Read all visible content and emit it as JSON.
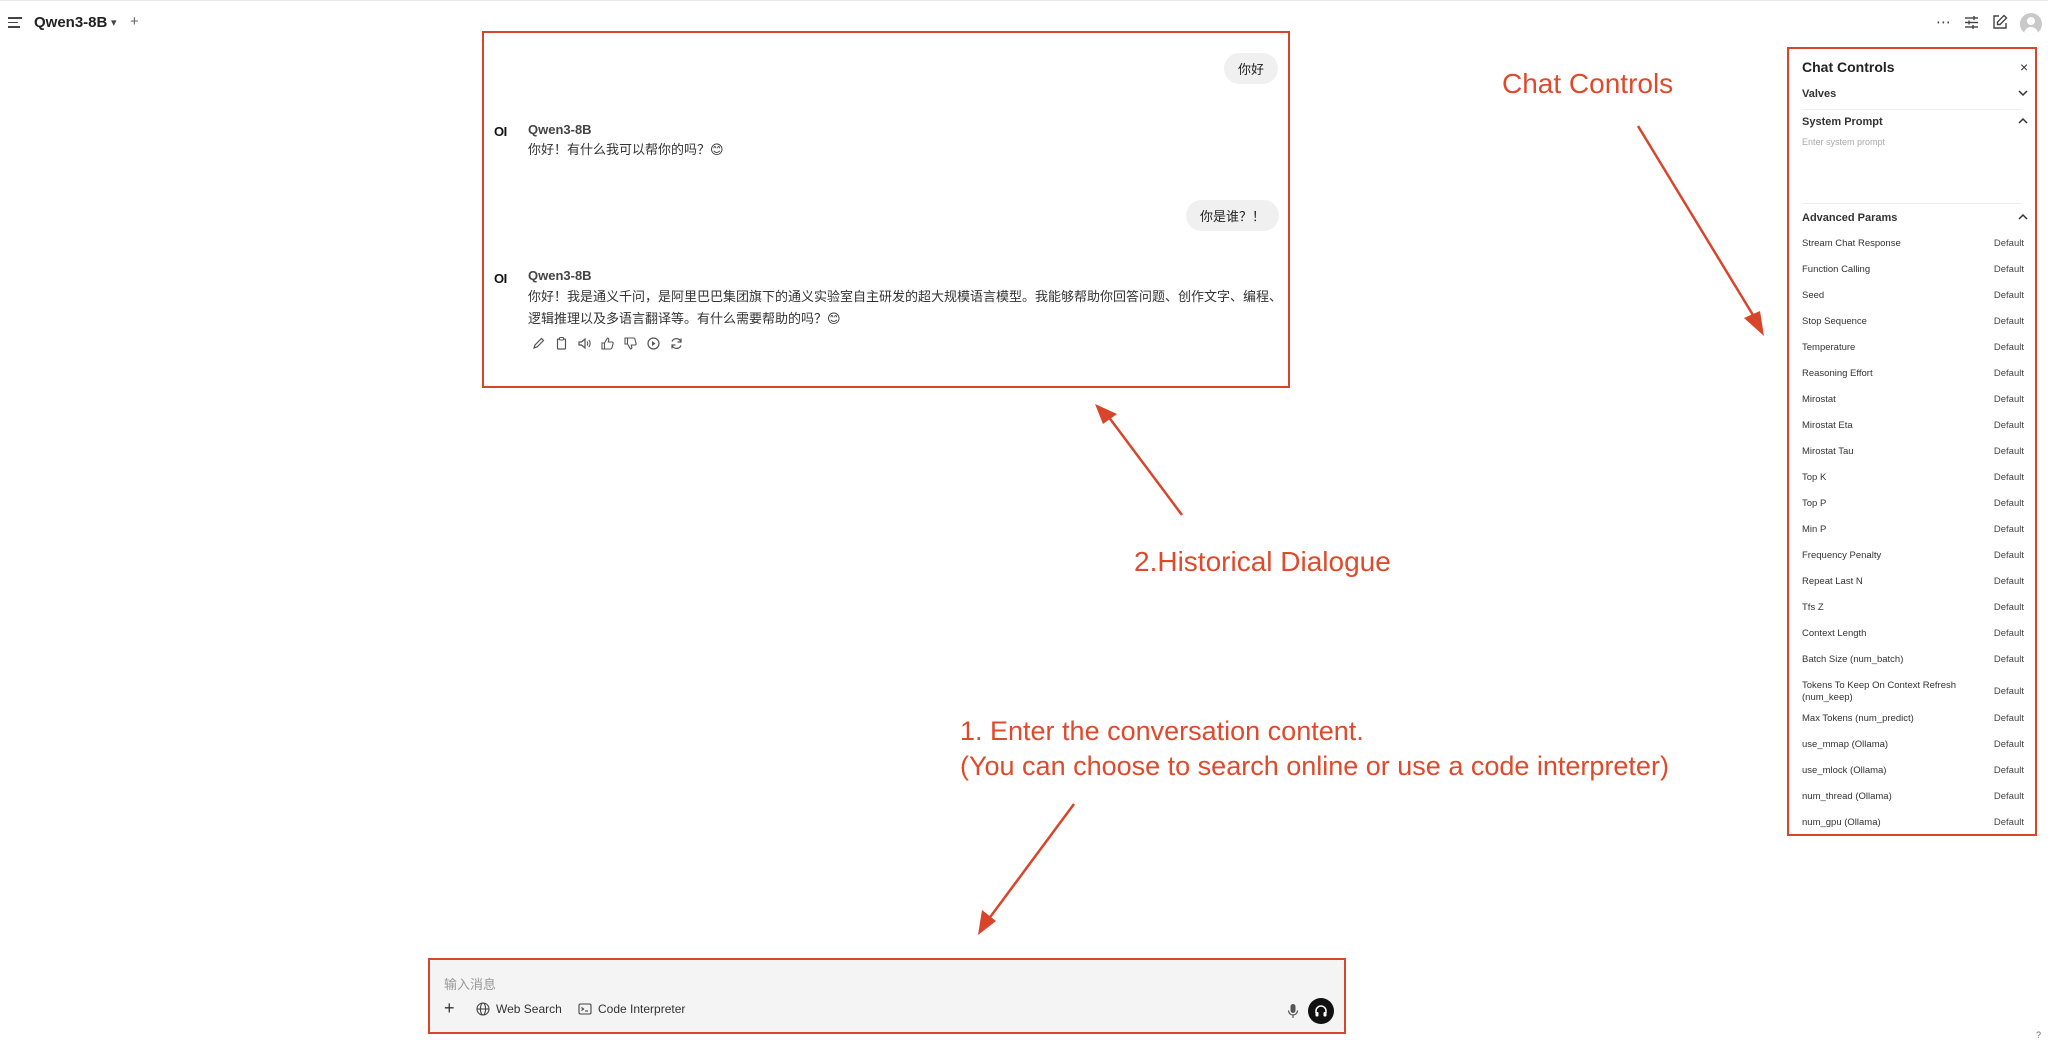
{
  "header": {
    "model_name": "Qwen3-8B",
    "chevron": "▾",
    "new_chat": "+",
    "more": "⋯"
  },
  "chat": {
    "messages": [
      {
        "role": "user",
        "text": "你好"
      },
      {
        "role": "assistant",
        "model": "Qwen3-8B",
        "logo": "OI",
        "text": "你好！有什么我可以帮你的吗？😊"
      },
      {
        "role": "user",
        "text": "你是谁？！"
      },
      {
        "role": "assistant",
        "model": "Qwen3-8B",
        "logo": "OI",
        "text_line1": "你好！我是通义千问，是阿里巴巴集团旗下的通义实验室自主研发的超大规模语言模型。我能够帮助你回答问题、创作文字、编程、",
        "text_line2": "逻辑推理以及多语言翻译等。有什么需要帮助的吗？😊"
      }
    ],
    "actions": [
      "edit-icon",
      "copy-icon",
      "speaker-icon",
      "thumbs-up-icon",
      "thumbs-down-icon",
      "continue-icon",
      "regenerate-icon"
    ]
  },
  "input": {
    "placeholder": "输入消息",
    "plus": "+",
    "web_search_label": "Web Search",
    "code_interpreter_label": "Code Interpreter"
  },
  "chat_controls": {
    "title": "Chat Controls",
    "close": "×",
    "valves_label": "Valves",
    "system_prompt_label": "System Prompt",
    "system_prompt_placeholder": "Enter system prompt",
    "advanced_params_label": "Advanced Params",
    "params": [
      {
        "name": "Stream Chat Response",
        "value": "Default"
      },
      {
        "name": "Function Calling",
        "value": "Default"
      },
      {
        "name": "Seed",
        "value": "Default"
      },
      {
        "name": "Stop Sequence",
        "value": "Default"
      },
      {
        "name": "Temperature",
        "value": "Default"
      },
      {
        "name": "Reasoning Effort",
        "value": "Default"
      },
      {
        "name": "Mirostat",
        "value": "Default"
      },
      {
        "name": "Mirostat Eta",
        "value": "Default"
      },
      {
        "name": "Mirostat Tau",
        "value": "Default"
      },
      {
        "name": "Top K",
        "value": "Default"
      },
      {
        "name": "Top P",
        "value": "Default"
      },
      {
        "name": "Min P",
        "value": "Default"
      },
      {
        "name": "Frequency Penalty",
        "value": "Default"
      },
      {
        "name": "Repeat Last N",
        "value": "Default"
      },
      {
        "name": "Tfs Z",
        "value": "Default"
      },
      {
        "name": "Context Length",
        "value": "Default"
      },
      {
        "name": "Batch Size (num_batch)",
        "value": "Default"
      },
      {
        "name": "Tokens To Keep On Context Refresh (num_keep)",
        "value": "Default"
      },
      {
        "name": "Max Tokens (num_predict)",
        "value": "Default"
      },
      {
        "name": "use_mmap (Ollama)",
        "value": "Default"
      },
      {
        "name": "use_mlock (Ollama)",
        "value": "Default"
      },
      {
        "name": "num_thread (Ollama)",
        "value": "Default"
      },
      {
        "name": "num_gpu (Ollama)",
        "value": "Default"
      }
    ]
  },
  "annotations": {
    "chat_controls": "Chat Controls",
    "historical": "2.Historical Dialogue",
    "enter_line1": "1. Enter the conversation content.",
    "enter_line2": "(You can choose to search online or use a code interpreter)"
  },
  "help_mark": "?",
  "colors": {
    "annotation_red": "#d8452a",
    "input_bg": "#f4f4f4",
    "bubble_bg": "#f0f0f0"
  }
}
